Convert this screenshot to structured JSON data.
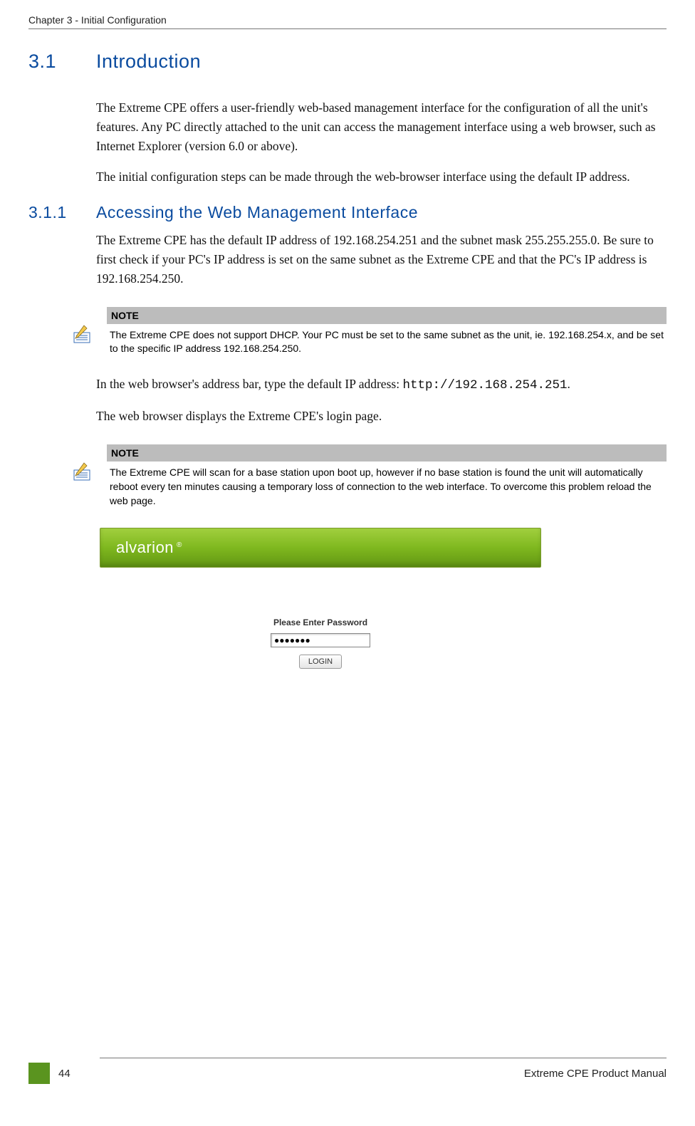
{
  "runningHead": "Chapter 3 - Initial Configuration",
  "section31": {
    "num": "3.1",
    "title": "Introduction"
  },
  "intro_p1": "The Extreme CPE offers a user-friendly web-based management interface for the configuration of all the unit's features. Any PC directly attached to the unit can access the management interface using a web browser, such as Internet Explorer (version 6.0 or above).",
  "intro_p2": "The initial configuration steps can be made through the web-browser interface using the default IP address.",
  "section311": {
    "num": "3.1.1",
    "title": "Accessing the Web Management Interface"
  },
  "access_p1": "The Extreme CPE has the default IP address of 192.168.254.251 and the subnet mask 255.255.255.0. Be sure to first check if your PC's IP address is set on the same subnet as the Extreme CPE  and that the PC's IP address is 192.168.254.250.",
  "note1": {
    "label": "NOTE",
    "text": "The Extreme CPE does not support DHCP. Your PC must be set to the same subnet as the unit, ie. 192.168.254.x, and be set to the specific IP address 192.168.254.250."
  },
  "access_p2_pre": "In the web browser's address bar, type the default IP address: ",
  "access_p2_url": "http://192.168.254.251",
  "access_p2_post": ".",
  "access_p3": "The web browser displays the Extreme CPE's login page.",
  "note2": {
    "label": "NOTE",
    "text": "The Extreme CPE will scan for a base station upon boot up, however if no base station is found the unit will automatically reboot every ten minutes causing a temporary loss of connection to the web interface. To overcome this problem reload the web page."
  },
  "login": {
    "brand": "alvarion",
    "prompt": "Please Enter Password",
    "passwordMask": "●●●●●●●",
    "button": "LOGIN"
  },
  "footer": {
    "pageNum": "44",
    "docTitle": "Extreme CPE Product Manual"
  }
}
